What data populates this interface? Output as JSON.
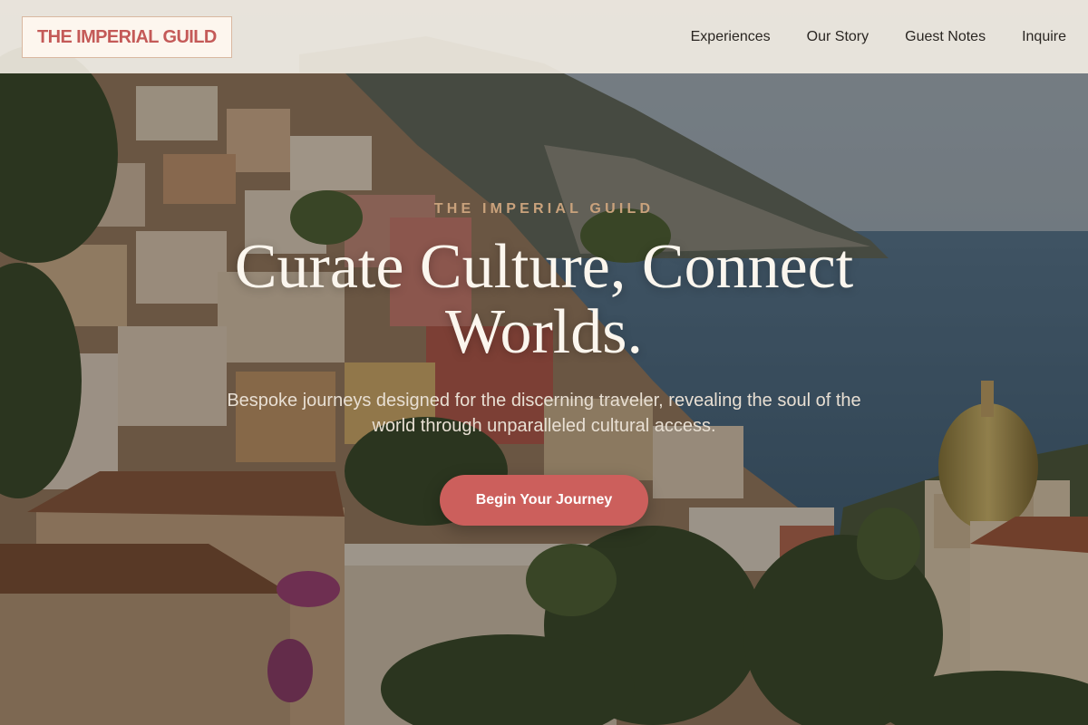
{
  "header": {
    "logo_text": "THE IMPERIAL GUILD",
    "nav": [
      {
        "label": "Experiences"
      },
      {
        "label": "Our Story"
      },
      {
        "label": "Guest Notes"
      },
      {
        "label": "Inquire"
      }
    ]
  },
  "hero": {
    "eyebrow": "THE IMPERIAL GUILD",
    "headline": "Curate Culture, Connect Worlds.",
    "subtitle": "Bespoke journeys designed for the discerning traveler, revealing the soul of the world through unparalleled cultural access.",
    "cta_label": "Begin Your Journey",
    "background_scene": "coastal-cliffside-village-photo"
  },
  "colors": {
    "brand": "#c45a58",
    "cta": "#cc5f5c",
    "eyebrow": "#c9a27c",
    "header_bg": "#f4eee4",
    "headline": "#fbf6ee"
  }
}
